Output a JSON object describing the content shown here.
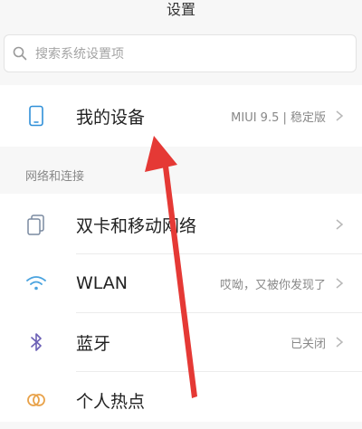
{
  "header": {
    "title": "设置"
  },
  "search": {
    "placeholder": "搜索系统设置项"
  },
  "device": {
    "label": "我的设备",
    "value": "MIUI 9.5 | 稳定版"
  },
  "network_section": {
    "title": "网络和连接"
  },
  "items": [
    {
      "label": "双卡和移动网络",
      "value": ""
    },
    {
      "label": "WLAN",
      "value": "哎呦，又被你发现了"
    },
    {
      "label": "蓝牙",
      "value": "已关闭"
    },
    {
      "label": "个人热点",
      "value": ""
    }
  ],
  "colors": {
    "arrow": "#e53935",
    "wifi": "#4aa3df",
    "bluetooth": "#6b5fb5",
    "hotspot": "#e8a24a",
    "device": "#2f8fd8"
  }
}
